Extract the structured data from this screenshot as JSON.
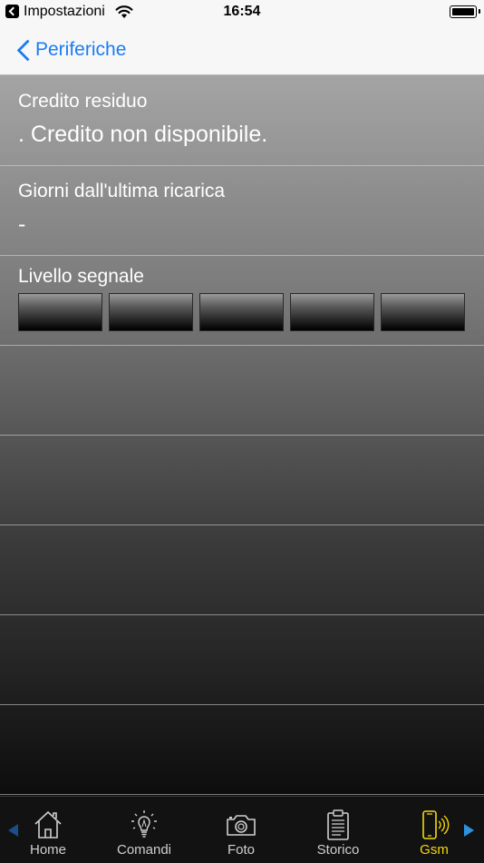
{
  "status_bar": {
    "app_name": "Impostazioni",
    "time": "16:54",
    "icons": [
      "back-to-app-icon",
      "wifi-icon",
      "battery-icon"
    ]
  },
  "nav": {
    "back_label": "Periferiche"
  },
  "rows": [
    {
      "title": "Credito residuo",
      "value": ". Credito non disponibile."
    },
    {
      "title": "Giorni dall'ultima ricarica",
      "value": "-"
    },
    {
      "title": "Livello segnale",
      "signal_bars_total": 5,
      "signal_bars_lit": 0
    }
  ],
  "tabs": [
    {
      "label": "Home",
      "icon": "home-icon",
      "active": false
    },
    {
      "label": "Comandi",
      "icon": "lightbulb-icon",
      "active": false
    },
    {
      "label": "Foto",
      "icon": "camera-icon",
      "active": false
    },
    {
      "label": "Storico",
      "icon": "clipboard-icon",
      "active": false
    },
    {
      "label": "Gsm",
      "icon": "phone-signal-icon",
      "active": true
    }
  ],
  "colors": {
    "accent": "#1a7cf5",
    "active_tab": "#f5d90a",
    "tab_bar": "#121212"
  }
}
